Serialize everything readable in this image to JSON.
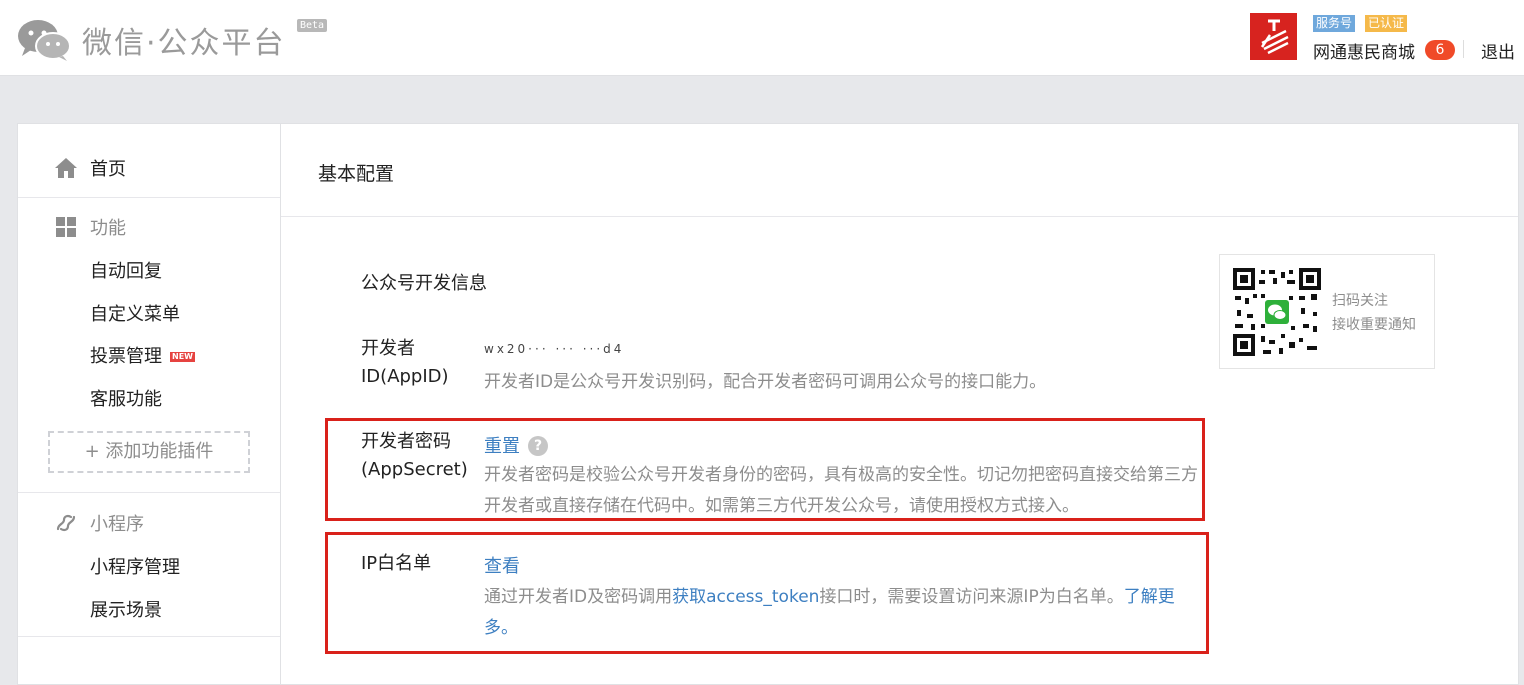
{
  "header": {
    "logo_text": "微信·公众平台",
    "beta": "Beta",
    "account": {
      "type_tag": "服务号",
      "verified_tag": "已认证",
      "name": "网通惠民商城",
      "message_count": "6"
    },
    "logout": "退出"
  },
  "sidebar": {
    "home": "首页",
    "function_group": "功能",
    "function_items": [
      "自动回复",
      "自定义菜单",
      "投票管理",
      "客服功能"
    ],
    "new_badge": "NEW",
    "add_plugin": "+ 添加功能插件",
    "miniprogram_group": "小程序",
    "miniprogram_items": [
      "小程序管理",
      "展示场景"
    ]
  },
  "main": {
    "page_title": "基本配置",
    "section_title": "公众号开发信息",
    "appid": {
      "label": "开发者ID(AppID)",
      "value": "wx20··· ··· ···d4",
      "desc": "开发者ID是公众号开发识别码，配合开发者密码可调用公众号的接口能力。"
    },
    "appsecret": {
      "label": "开发者密码(AppSecret)",
      "reset_link": "重置",
      "help": "?",
      "desc": "开发者密码是校验公众号开发者身份的密码，具有极高的安全性。切记勿把密码直接交给第三方开发者或直接存储在代码中。如需第三方代开发公众号，请使用授权方式接入。"
    },
    "ip_whitelist": {
      "label": "IP白名单",
      "view_link": "查看",
      "desc_before": "通过开发者ID及密码调用",
      "desc_link": "获取access_token",
      "desc_after": "接口时，需要设置访问来源IP为白名单。",
      "learn_more": "了解更多。"
    },
    "qr": {
      "line1": "扫码关注",
      "line2": "接收重要通知"
    }
  },
  "colors": {
    "link": "#3d7fc1",
    "highlight": "#d9211a",
    "badge": "#f04a28",
    "brand": "#d7231f"
  }
}
